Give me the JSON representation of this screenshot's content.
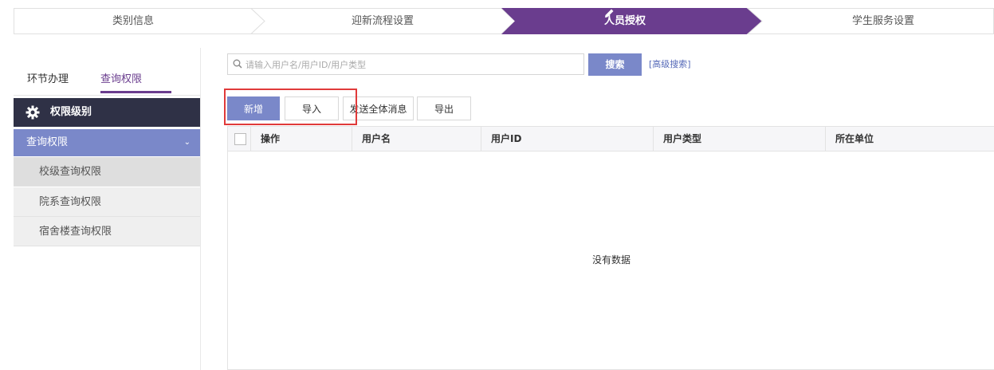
{
  "steps": [
    {
      "label": "类别信息",
      "active": false
    },
    {
      "label": "迎新流程设置",
      "active": false
    },
    {
      "label": "人员授权",
      "active": true,
      "icon": "pencil-icon"
    },
    {
      "label": "学生服务设置",
      "active": false
    }
  ],
  "colors": {
    "accent_purple": "#6a3d8e",
    "dark_header": "#2f3146",
    "button_blue": "#7a88c9",
    "highlight_red": "#e03a3a"
  },
  "left": {
    "tabs": [
      {
        "label": "环节办理",
        "active": false
      },
      {
        "label": "查询权限",
        "active": true
      }
    ],
    "header": {
      "label": "权限级别",
      "icon": "gear-icon"
    },
    "group": {
      "label": "查询权限",
      "expanded": true,
      "icon": "chevron-down-icon"
    },
    "items": [
      {
        "label": "校级查询权限",
        "selected": true
      },
      {
        "label": "院系查询权限",
        "selected": false
      },
      {
        "label": "宿舍楼查询权限",
        "selected": false
      }
    ]
  },
  "search": {
    "placeholder": "请输入用户名/用户ID/用户类型",
    "value": "",
    "button": "搜索",
    "advanced": "[高级搜索]"
  },
  "toolbar": {
    "add": "新增",
    "import": "导入",
    "broadcast": "发送全体消息",
    "export": "导出"
  },
  "table": {
    "columns": [
      "操作",
      "用户名",
      "用户ID",
      "用户类型",
      "所在单位"
    ],
    "rows": [],
    "empty": "没有数据"
  }
}
